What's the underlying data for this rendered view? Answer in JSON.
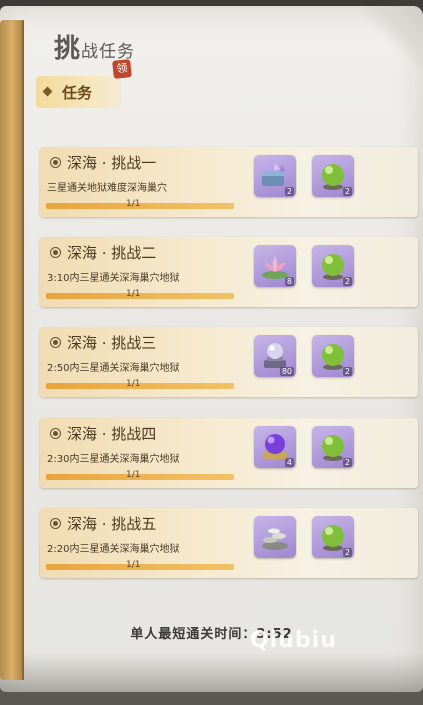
{
  "title": {
    "first_char": "挑",
    "rest": "战任务"
  },
  "tab": {
    "label": "任务",
    "badge": "领"
  },
  "challenges": [
    {
      "title": "深海 · 挑战一",
      "desc": "三星通关地狱难度深海巢穴",
      "progress_text": "1/1",
      "progress": 1.0,
      "rewards": [
        {
          "icon": "crystal-chest-icon",
          "count": "2"
        },
        {
          "icon": "green-orb-icon",
          "count": "2"
        }
      ]
    },
    {
      "title": "深海 · 挑战二",
      "desc": "3:10内三星通关深海巢穴地狱",
      "progress_text": "1/1",
      "progress": 1.0,
      "rewards": [
        {
          "icon": "lotus-icon",
          "count": "8"
        },
        {
          "icon": "green-orb-icon",
          "count": "2"
        }
      ]
    },
    {
      "title": "深海 · 挑战三",
      "desc": "2:50内三星通关深海巢穴地狱",
      "progress_text": "1/1",
      "progress": 1.0,
      "rewards": [
        {
          "icon": "silver-orb-stand-icon",
          "count": "80"
        },
        {
          "icon": "green-orb-icon",
          "count": "2"
        }
      ]
    },
    {
      "title": "深海 · 挑战四",
      "desc": "2:30内三星通关深海巢穴地狱",
      "progress_text": "1/1",
      "progress": 1.0,
      "rewards": [
        {
          "icon": "purple-orb-icon",
          "count": "4"
        },
        {
          "icon": "green-orb-icon",
          "count": "2"
        }
      ]
    },
    {
      "title": "深海 · 挑战五",
      "desc": "2:20内三星通关深海巢穴地狱",
      "progress_text": "1/1",
      "progress": 1.0,
      "rewards": [
        {
          "icon": "coin-pile-icon",
          "count": ""
        },
        {
          "icon": "green-orb-icon",
          "count": "2"
        }
      ]
    }
  ],
  "footer": {
    "text": "单人最短通关时间：3:52"
  },
  "watermark": "Qiubiu",
  "colors": {
    "progress_fill": "#e8a43c",
    "reward_frame": "#9f86cf",
    "badge": "#c0472a"
  }
}
